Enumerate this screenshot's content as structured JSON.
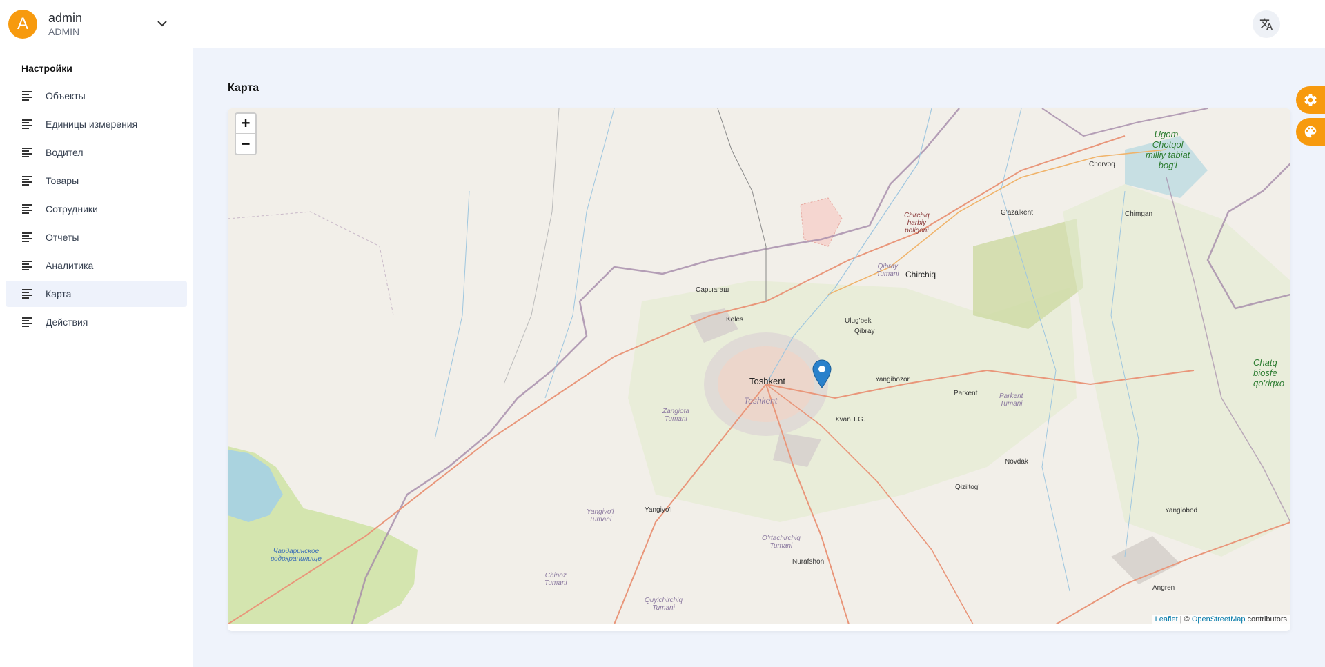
{
  "profile": {
    "initial": "A",
    "name": "admin",
    "role": "ADMIN"
  },
  "sidebar": {
    "section_title": "Настройки",
    "items": [
      {
        "label": "Объекты"
      },
      {
        "label": "Единицы измерения"
      },
      {
        "label": "Водител"
      },
      {
        "label": "Товары"
      },
      {
        "label": "Сотрудники"
      },
      {
        "label": "Отчеты"
      },
      {
        "label": "Аналитика"
      },
      {
        "label": "Карта",
        "active": true
      },
      {
        "label": "Действия"
      }
    ]
  },
  "main": {
    "title": "Карта"
  },
  "map": {
    "zoom_in": "+",
    "zoom_out": "−",
    "attribution": {
      "leaflet": "Leaflet",
      "sep": " | © ",
      "osm": "OpenStreetMap",
      "suffix": " contributors"
    },
    "labels": {
      "toshkent": "Toshkent",
      "toshkent_district": "Toshkent",
      "chirchiq": "Chirchiq",
      "keles": "Keles",
      "saryagash": "Сарыагаш",
      "ulugbek": "Ulug'bek",
      "qibray": "Qibray",
      "qibray_tumani": "Qibray\nTumani",
      "yangibozor": "Yangibozor",
      "xvan": "Xvan T.G.",
      "parkent": "Parkent",
      "parkent_tumani": "Parkent\nTumani",
      "zangiota": "Zangiota\nTumani",
      "novdak": "Novdak",
      "qiziltog": "Qiziltog'",
      "yangiyol": "Yangiyo'l",
      "yangiyol_tumani": "Yangiyo'l\nTumani",
      "ortachirchiq": "O'rtachirchiq\nTumani",
      "nurafshon": "Nurafshon",
      "chinoz": "Chinoz\nTumani",
      "quyichirchiq": "Quyichirchiq\nTumani",
      "yangiobod": "Yangiobod",
      "angren": "Angren",
      "chorvoq": "Chorvoq",
      "gazalkent": "G'azalkent",
      "chimgan": "Chimgan",
      "ugom": "Ugom-\nChotqol\nmilliy tabiat\nbog'i",
      "chatqol": "Chatq\nbiosfe\nqo'riqxo",
      "chirchiq_poligon": "Chirchiq\nharbiy\npoligoni",
      "chardara": "Чардаринское\nводохранилище"
    }
  },
  "colors": {
    "accent": "#f79a0e",
    "active_bg": "#eef2fb",
    "marker": "#2a81cb"
  },
  "icons": {
    "menu": "list-icon",
    "chevron": "chevron-down-icon",
    "translate": "translate-icon",
    "settings": "gear-icon",
    "palette": "palette-icon",
    "marker": "map-marker-icon"
  }
}
